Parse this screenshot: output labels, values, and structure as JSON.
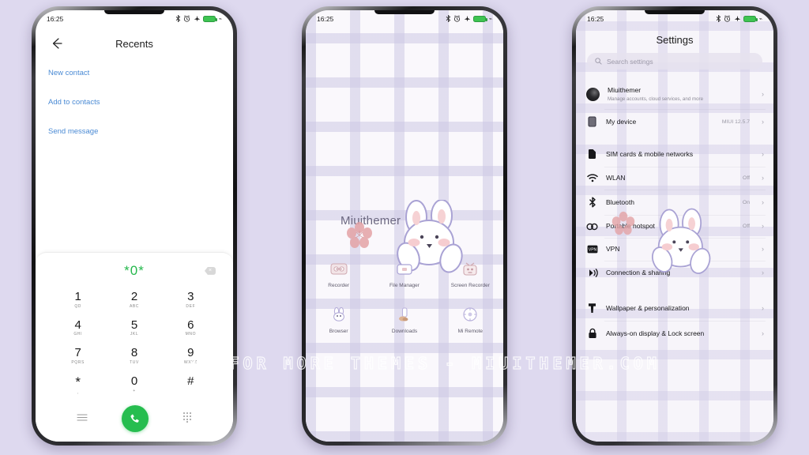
{
  "background_color": "#ded9ef",
  "watermark": "VISIT FOR MORE THEMES - MIUITHEMER.COM",
  "status_bar": {
    "time": "16:25",
    "icons": [
      "bluetooth-icon",
      "alarm-icon",
      "airplane-mode-icon",
      "battery-icon"
    ],
    "battery_color": "#3ec452"
  },
  "phone1": {
    "screen_name": "dialer-recents",
    "header": {
      "back_icon": "back-arrow-icon",
      "title": "Recents"
    },
    "links": [
      {
        "label": "New contact"
      },
      {
        "label": "Add to contacts"
      },
      {
        "label": "Send message"
      }
    ],
    "link_color": "#4a8ad4",
    "dialer": {
      "number": "*0*",
      "number_color": "#25b84c",
      "backspace_icon": "backspace-icon",
      "keys": [
        {
          "digit": "1",
          "sub": "QD"
        },
        {
          "digit": "2",
          "sub": "ABC"
        },
        {
          "digit": "3",
          "sub": "DEF"
        },
        {
          "digit": "4",
          "sub": "GHI"
        },
        {
          "digit": "5",
          "sub": "JKL"
        },
        {
          "digit": "6",
          "sub": "MNO"
        },
        {
          "digit": "7",
          "sub": "PQRS"
        },
        {
          "digit": "8",
          "sub": "TUV"
        },
        {
          "digit": "9",
          "sub": "WXYZ"
        },
        {
          "digit": "*",
          "sub": ","
        },
        {
          "digit": "0",
          "sub": "+"
        },
        {
          "digit": "#",
          "sub": ""
        }
      ],
      "bottom": {
        "menu_icon": "menu-icon",
        "call_icon": "call-icon",
        "call_button_color": "#26bd4f",
        "keypad_icon": "keypad-icon"
      }
    }
  },
  "phone2": {
    "screen_name": "home-screen",
    "widget_text": "Miuithemer",
    "wallpaper": "plaid-lavender-bunny",
    "apps": [
      {
        "label": "Recorder",
        "icon": "cassette-recorder-icon"
      },
      {
        "label": "File Manager",
        "icon": "folder-file-manager-icon"
      },
      {
        "label": "Screen Recorder",
        "icon": "tv-screen-recorder-icon"
      },
      {
        "label": "Browser",
        "icon": "bunny-browser-icon"
      },
      {
        "label": "Downloads",
        "icon": "download-arrow-icon"
      },
      {
        "label": "Mi Remote",
        "icon": "remote-circle-icon"
      }
    ]
  },
  "phone3": {
    "screen_name": "settings",
    "title": "Settings",
    "search": {
      "placeholder": "Search settings",
      "icon": "search-icon"
    },
    "groups": [
      {
        "rows": [
          {
            "label": "Miuithemer",
            "sub": "Manage accounts, cloud services, and more",
            "value": "",
            "icon": "account-avatar-icon"
          },
          {
            "label": "My device",
            "sub": "",
            "value": "MIUI 12.5.7",
            "icon": "device-icon"
          }
        ]
      },
      {
        "rows": [
          {
            "label": "SIM cards & mobile networks",
            "sub": "",
            "value": "",
            "icon": "sim-card-icon"
          },
          {
            "label": "WLAN",
            "sub": "",
            "value": "Off",
            "icon": "wifi-icon"
          },
          {
            "label": "Bluetooth",
            "sub": "",
            "value": "On",
            "icon": "bluetooth-icon"
          },
          {
            "label": "Portable hotspot",
            "sub": "",
            "value": "Off",
            "icon": "hotspot-icon"
          },
          {
            "label": "VPN",
            "sub": "",
            "value": "",
            "icon": "vpn-icon"
          },
          {
            "label": "Connection & sharing",
            "sub": "",
            "value": "",
            "icon": "connection-sharing-icon"
          }
        ]
      },
      {
        "rows": [
          {
            "label": "Wallpaper & personalization",
            "sub": "",
            "value": "",
            "icon": "wallpaper-icon"
          },
          {
            "label": "Always-on display & Lock screen",
            "sub": "",
            "value": "",
            "icon": "lock-icon"
          }
        ]
      }
    ],
    "chevron": "›"
  }
}
